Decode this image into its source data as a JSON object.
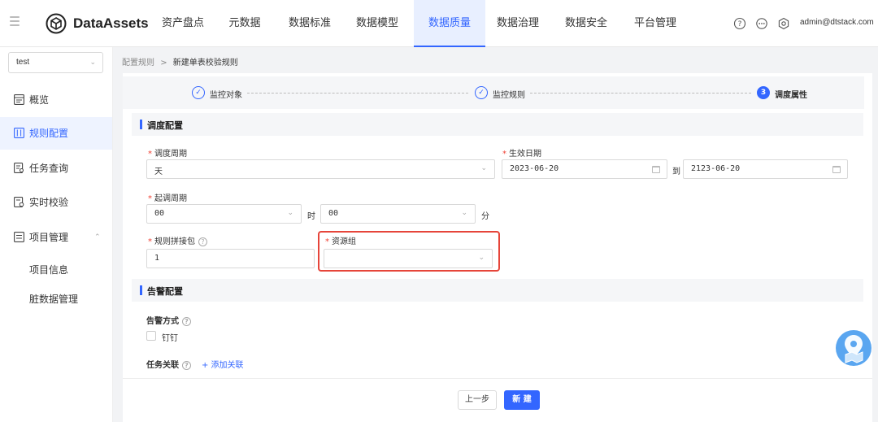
{
  "header": {
    "brand": "DataAssets",
    "nav": [
      "资产盘点",
      "元数据",
      "数据标准",
      "数据模型",
      "数据质量",
      "数据治理",
      "数据安全",
      "平台管理"
    ],
    "active_nav": "数据质量",
    "user": "admin@dtstack.com",
    "icons": [
      "help-icon",
      "message-icon",
      "settings-icon"
    ]
  },
  "sidebar": {
    "project": "test",
    "items": [
      {
        "label": "概览",
        "icon": "overview-icon"
      },
      {
        "label": "规则配置",
        "icon": "rule-config-icon"
      },
      {
        "label": "任务查询",
        "icon": "task-query-icon"
      },
      {
        "label": "实时校验",
        "icon": "realtime-check-icon"
      },
      {
        "label": "项目管理",
        "icon": "project-manage-icon"
      }
    ],
    "active_item": "规则配置",
    "sub_items": [
      "项目信息",
      "脏数据管理"
    ]
  },
  "breadcrumb": {
    "parent": "配置规则",
    "separator": ">",
    "current": "新建单表校验规则"
  },
  "steps": [
    {
      "label": "监控对象",
      "state": "done"
    },
    {
      "label": "监控规则",
      "state": "done"
    },
    {
      "label": "调度属性",
      "state": "current",
      "number": "3"
    }
  ],
  "schedule": {
    "title": "调度配置",
    "cycle_label": "调度周期",
    "cycle_value": "天",
    "date_label": "生效日期",
    "date_start": "2023-06-20",
    "date_to": "到",
    "date_end": "2123-06-20",
    "start_label": "起调周期",
    "hour_value": "00",
    "hour_unit": "时",
    "minute_value": "00",
    "minute_unit": "分",
    "pkg_label": "规则拼接包",
    "pkg_value": "1",
    "resource_label": "资源组",
    "resource_value": ""
  },
  "alarm": {
    "title": "告警配置",
    "method_label": "告警方式",
    "dingtalk_label": "钉钉",
    "dingtalk_checked": false,
    "task_label": "任务关联",
    "add_link": "+ 添加关联"
  },
  "footer": {
    "prev": "上一步",
    "create": "新 建"
  },
  "colors": {
    "primary": "#3366ff",
    "required": "#f04134",
    "highlight": "#e6453a"
  }
}
